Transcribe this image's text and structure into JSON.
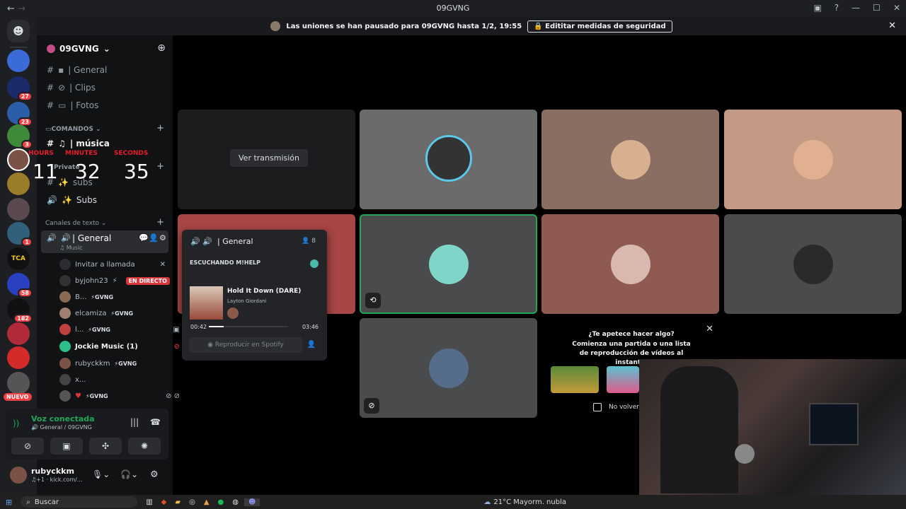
{
  "window": {
    "title": "09GVNG",
    "back": "←",
    "forward": "→"
  },
  "notice": {
    "text": "Las uniones se han pausado para 09GVNG hasta 1/2, 19:55",
    "button": "Edititar medidas de seguridad"
  },
  "server": {
    "name": "09GVNG"
  },
  "rail_badges": [
    "27",
    "23",
    "3",
    "1",
    "58",
    "182"
  ],
  "rail_new": "NUEVO",
  "channels": {
    "text_top": [
      "| General",
      "| Clips",
      "| Fotos"
    ],
    "cat_comandos": "COMANDOS",
    "musica": "| música",
    "private_cat": "Private",
    "subs_text": "subs",
    "subs_voice": "Subs",
    "cat_text": "Canales de texto",
    "voice_general": "| General",
    "voice_general_sub": "Music",
    "invite": "Invitar a llamada",
    "users": [
      {
        "name": "byjohn23",
        "tag": "",
        "live": "EN DIRECTO"
      },
      {
        "name": "B...",
        "tag": "⚡GVNG",
        "live": ""
      },
      {
        "name": "elcamiza",
        "tag": "⚡GVNG",
        "live": ""
      },
      {
        "name": "l...",
        "tag": "⚡GVNG",
        "live": ""
      },
      {
        "name": "Jockie Music (1)",
        "tag": "",
        "live": ""
      },
      {
        "name": "rubyckkm",
        "tag": "⚡GVNG",
        "live": ""
      },
      {
        "name": "x...",
        "tag": "",
        "live": ""
      },
      {
        "name": "",
        "tag": "⚡GVNG",
        "live": ""
      }
    ]
  },
  "timer": {
    "hours_label": "HOURS",
    "minutes_label": "MINUTES",
    "seconds_label": "SECONDS",
    "hours": "11",
    "minutes": "32",
    "seconds": "35"
  },
  "voice": {
    "status": "Voz conectada",
    "location": "General / 09GVNG"
  },
  "userbar": {
    "name": "rubyckkm",
    "status": "kick.com/..."
  },
  "stream": {
    "button": "Ver transmisión"
  },
  "popup": {
    "title": "| General",
    "count": "8",
    "listening": "ESCUCHANDO M!HELP",
    "track": "Hold It Down (DARE)",
    "artist": "Layton Giordani",
    "elapsed": "00:42",
    "duration": "03:46",
    "progress": 0.186,
    "spotify": "Reproducir en Spotify"
  },
  "activity": {
    "line1": "¿Te apetece hacer algo?",
    "line2": "Comienza una partida o una lista de reproducción de vídeos al instante.",
    "checkbox": "No volver"
  },
  "taskbar": {
    "search": "Buscar",
    "weather": "21°C  Mayorm. nubla"
  }
}
